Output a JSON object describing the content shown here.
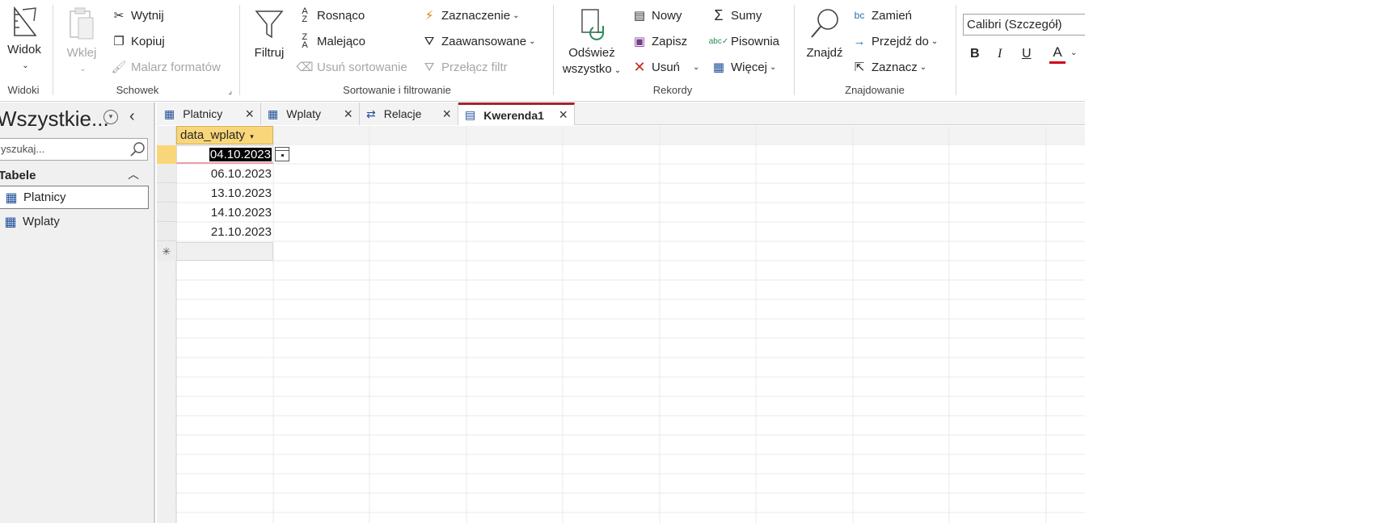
{
  "ribbon": {
    "views": {
      "view_label": "Widok",
      "group": "Widoki"
    },
    "clipboard": {
      "paste": "Wklej",
      "cut": "Wytnij",
      "copy": "Kopiuj",
      "format_painter": "Malarz formatów",
      "group": "Schowek"
    },
    "sort_filter": {
      "filter": "Filtruj",
      "ascending": "Rosnąco",
      "descending": "Malejąco",
      "remove_sort": "Usuń sortowanie",
      "selection": "Zaznaczenie",
      "advanced": "Zaawansowane",
      "toggle_filter": "Przełącz filtr",
      "group": "Sortowanie i filtrowanie"
    },
    "records": {
      "refresh_line1": "Odśwież",
      "refresh_line2": "wszystko",
      "new": "Nowy",
      "save": "Zapisz",
      "delete": "Usuń",
      "totals": "Sumy",
      "spelling": "Pisownia",
      "more": "Więcej",
      "group": "Rekordy"
    },
    "find": {
      "find": "Znajdź",
      "replace": "Zamień",
      "goto": "Przejdź do",
      "select": "Zaznacz",
      "group": "Znajdowanie"
    },
    "text": {
      "font": "Calibri (Szczegół)",
      "bold": "B",
      "italic": "I",
      "underline": "U",
      "font_color": "A"
    }
  },
  "nav": {
    "title": "Wszystkie...",
    "search_placeholder": "yszukaj...",
    "section": "Tabele",
    "items": [
      {
        "label": "Platnicy"
      },
      {
        "label": "Wplaty"
      }
    ]
  },
  "tabs": [
    {
      "label": "Platnicy"
    },
    {
      "label": "Wplaty"
    },
    {
      "label": "Relacje"
    },
    {
      "label": "Kwerenda1"
    }
  ],
  "datasheet": {
    "column": "data_wplaty",
    "rows": [
      "04.10.2023",
      "06.10.2023",
      "13.10.2023",
      "14.10.2023",
      "21.10.2023"
    ],
    "new_row_marker": "✳"
  },
  "colors": {
    "accent": "#a4262c",
    "selected_row": "#fbdb7a",
    "header_bg": "#f3f3f3",
    "font_color_bar": "#d0021b"
  }
}
